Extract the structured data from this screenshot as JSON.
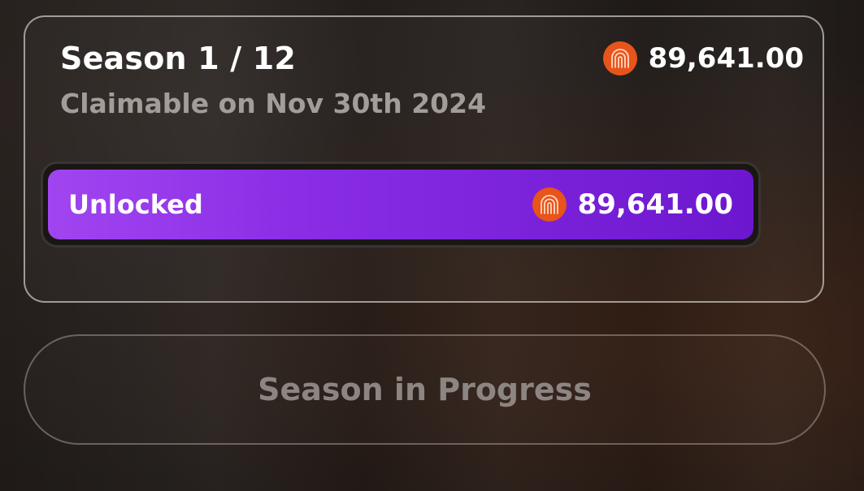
{
  "season": {
    "title": "Season 1 / 12",
    "claim_date": "Claimable on Nov 30th 2024",
    "amount": "89,641.00",
    "token_icon": "token-arch-icon"
  },
  "progress": {
    "label": "Unlocked",
    "amount": "89,641.00",
    "fill_fraction": 1.0,
    "token_icon": "token-arch-icon"
  },
  "action": {
    "button_label": "Season in Progress"
  },
  "colors": {
    "accent_purple_start": "#a145f1",
    "accent_purple_end": "#6c17cf",
    "token_orange": "#e8541a",
    "muted_text": "#a39d9a"
  }
}
